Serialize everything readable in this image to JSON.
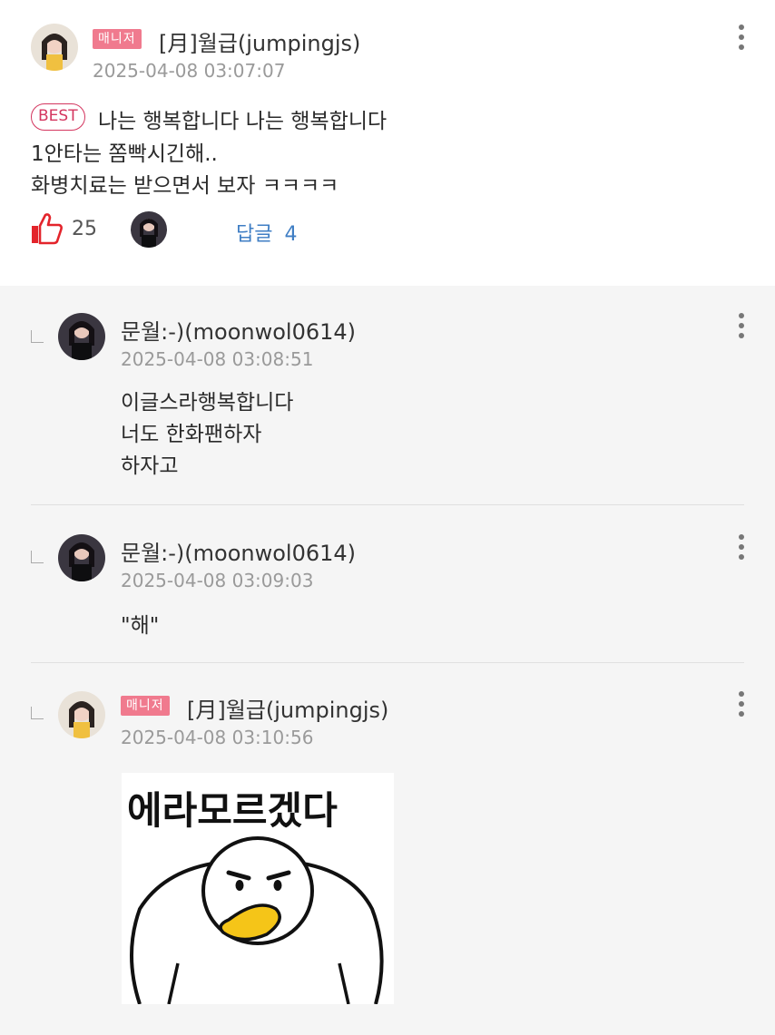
{
  "colors": {
    "manager_badge": "#f07a8e",
    "best_badge": "#d4365f",
    "like_icon": "#e3242b",
    "reply_link": "#3f7ec4"
  },
  "top_comment": {
    "badge": "매니저",
    "author": "[月]월급(jumpingjs)",
    "date": "2025-04-08 03:07:07",
    "best_label": "BEST",
    "lines": [
      "나는 행복합니다 나는 행복합니다",
      "1안타는 쫌빡시긴해..",
      "화병치료는 받으면서 보자 ㅋㅋㅋㅋ"
    ],
    "likes": "25",
    "reply_label": "답글",
    "reply_count": "4"
  },
  "replies": [
    {
      "author": "문월:-)(moonwol0614)",
      "date": "2025-04-08 03:08:51",
      "lines": [
        "이글스라행복합니다",
        "너도 한화팬하자",
        "하자고"
      ]
    },
    {
      "author": "문월:-)(moonwol0614)",
      "date": "2025-04-08 03:09:03",
      "lines": [
        "\"해\""
      ]
    },
    {
      "badge": "매니저",
      "author": "[月]월급(jumpingjs)",
      "date": "2025-04-08 03:10:56",
      "sticker_text": "에라모르겠다"
    }
  ]
}
